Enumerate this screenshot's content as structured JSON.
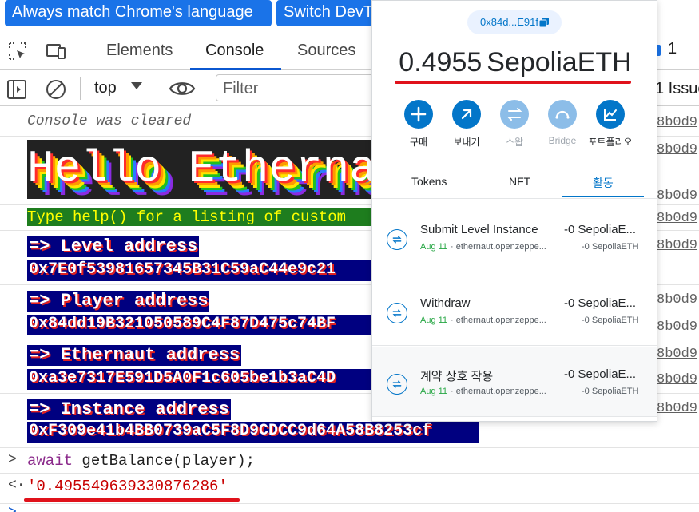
{
  "banner": {
    "match_language_label": "Always match Chrome's language",
    "switch_label": "Switch DevTools"
  },
  "devtools": {
    "tabs": [
      "Elements",
      "Console",
      "Sources"
    ],
    "active_tab": "Console",
    "issues_badge_count": "1",
    "issues_label": "1 Issue"
  },
  "console_toolbar": {
    "context": "top",
    "filter_placeholder": "Filter"
  },
  "console": {
    "cleared": "Console was cleared",
    "hello_banner": "Hello Ethernaut",
    "help_text": "Type help() for a listing of custom",
    "level_label": "=> Level address",
    "level_value": "0x7E0f53981657345B31C59aC44e9c21",
    "player_label": "=> Player address",
    "player_value": "0x84dd19B321050589C4F87D475c74BF",
    "ethernaut_label": "=> Ethernaut address",
    "ethernaut_value": "0xa3e7317E591D5A0F1c605be1b3aC4D",
    "instance_label": "=> Instance address",
    "instance_value": "0xF309e41b4BB0739aC5F8D9CDCC9d64A58B8253cf",
    "command_keyword": "await",
    "command_rest": " getBalance(player);",
    "result": "'0.495549639330876286'",
    "source_link": "8b0d9"
  },
  "wallet": {
    "account": "0x84d...E91f",
    "balance": "0.4955",
    "currency": "SepoliaETH",
    "actions": [
      {
        "label": "구매",
        "icon": "plus-icon",
        "disabled": false
      },
      {
        "label": "보내기",
        "icon": "send-arrow-icon",
        "disabled": false
      },
      {
        "label": "스왑",
        "icon": "swap-icon",
        "disabled": true
      },
      {
        "label": "Bridge",
        "icon": "bridge-icon",
        "disabled": true
      },
      {
        "label": "포트폴리오",
        "icon": "chart-icon",
        "disabled": false
      }
    ],
    "tabs": [
      "Tokens",
      "NFT",
      "활동"
    ],
    "active_tab": "활동",
    "transactions": [
      {
        "title": "Submit Level Instance",
        "date": "Aug 11",
        "origin": " · ethernaut.openzeppe...",
        "amount": "-0 SepoliaE...",
        "amount_sub": "-0 SepoliaETH"
      },
      {
        "title": "Withdraw",
        "date": "Aug 11",
        "origin": " · ethernaut.openzeppe...",
        "amount": "-0 SepoliaE...",
        "amount_sub": "-0 SepoliaETH"
      },
      {
        "title": "계약 상호 작용",
        "date": "Aug 11",
        "origin": " · ethernaut.openzeppe...",
        "amount": "-0 SepoliaE...",
        "amount_sub": "-0 SepoliaETH"
      }
    ]
  },
  "colors": {
    "accent_blue": "#1a73e8",
    "wallet_blue": "#0376c9",
    "highlight_red": "#e0121b",
    "address_bg": "#000080"
  }
}
